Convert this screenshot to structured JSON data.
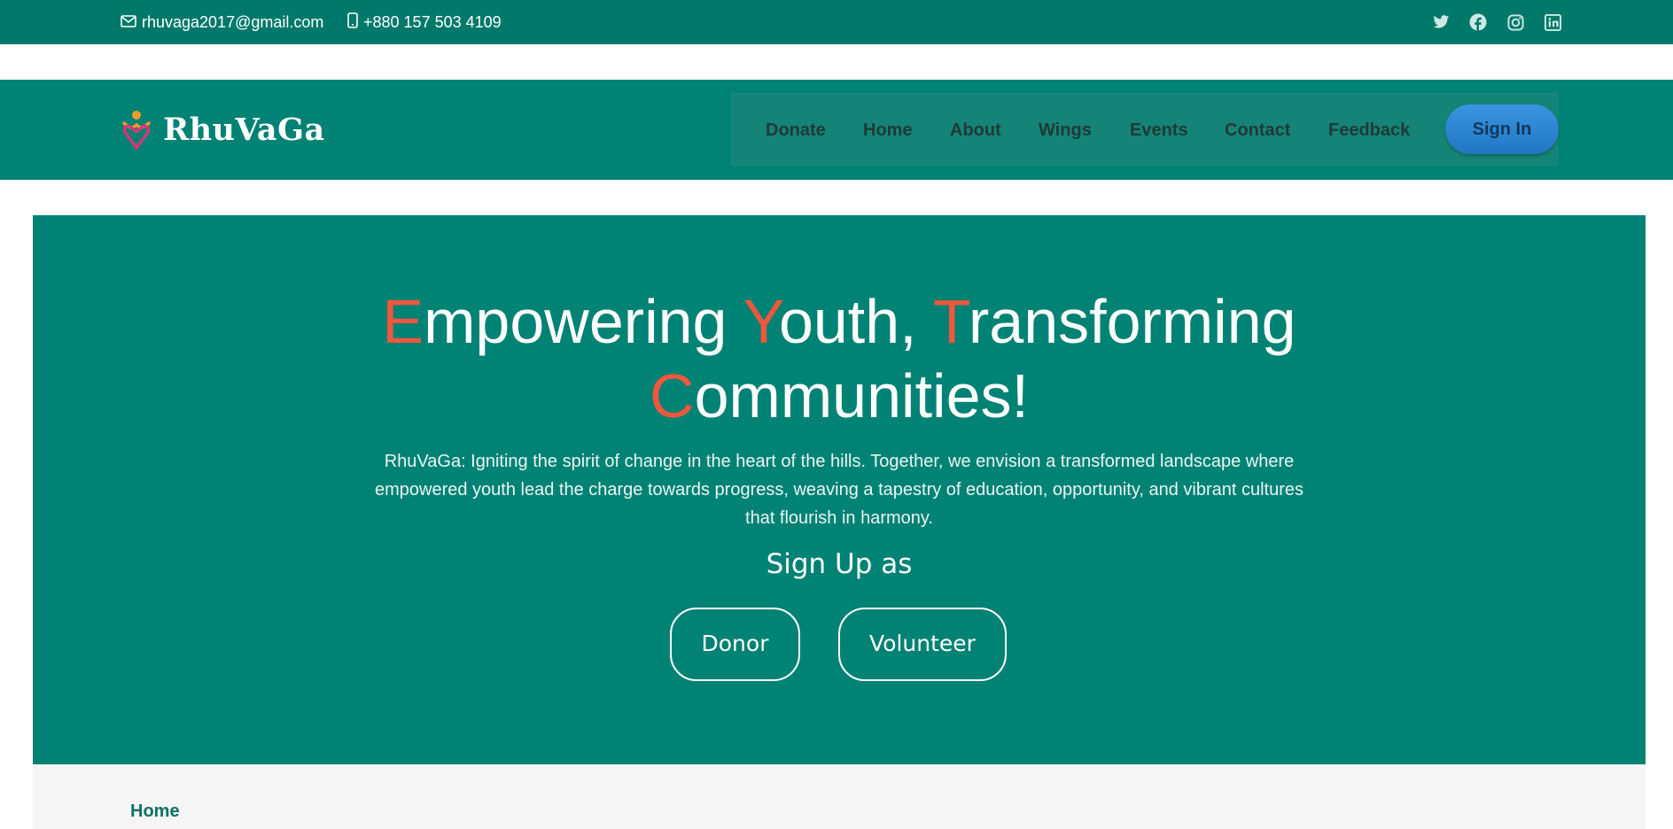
{
  "topbar": {
    "email": "rhuvaga2017@gmail.com",
    "phone": "+880 157 503 4109",
    "social_icons": [
      "twitter-icon",
      "facebook-icon",
      "instagram-icon",
      "linkedin-icon"
    ]
  },
  "header": {
    "brand": "RhuVaGa",
    "nav": [
      "Donate",
      "Home",
      "About",
      "Wings",
      "Events",
      "Contact",
      "Feedback"
    ],
    "signin_label": "Sign In"
  },
  "hero": {
    "title_line1": [
      {
        "accent": "E",
        "rest": "mpowering "
      },
      {
        "accent": "Y",
        "rest": "outh, "
      },
      {
        "accent": "T",
        "rest": "ransforming"
      }
    ],
    "title_line2": [
      {
        "accent": "C",
        "rest": "ommunities!"
      }
    ],
    "description": "RhuVaGa: Igniting the spirit of change in the heart of the hills. Together, we envision a transformed landscape where empowered youth lead the charge towards progress, weaving a tapestry of education, opportunity, and vibrant cultures that flourish in harmony.",
    "signup_label": "Sign Up as",
    "donor_label": "Donor",
    "volunteer_label": "Volunteer"
  },
  "breadcrumb": "Home",
  "colors": {
    "primary": "#008274",
    "topbar": "#00796b",
    "accent": "#f0573d",
    "signin": "#2e86d4"
  }
}
